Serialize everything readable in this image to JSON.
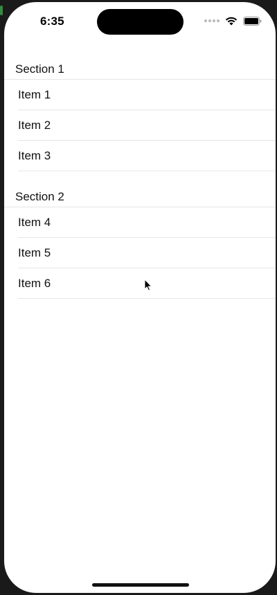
{
  "status_bar": {
    "time": "6:35",
    "icons": [
      "signal-dots-icon",
      "wifi-icon",
      "battery-icon"
    ]
  },
  "sections": [
    {
      "header": "Section 1",
      "items": [
        "Item 1",
        "Item 2",
        "Item 3"
      ]
    },
    {
      "header": "Section 2",
      "items": [
        "Item 4",
        "Item 5",
        "Item 6"
      ]
    }
  ],
  "colors": {
    "background": "#ffffff",
    "separator": "#e6e6e6",
    "text": "#111111"
  }
}
